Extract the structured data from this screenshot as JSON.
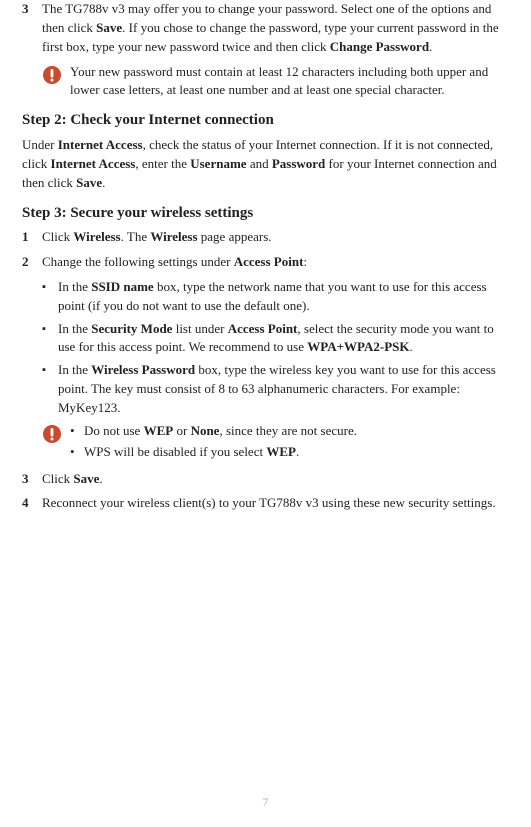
{
  "item3": {
    "num": "3",
    "t1": "The TG788v v3 may offer you to change your password. Select one of the options and then click ",
    "b1": "Save",
    "t2": ". If you chose to change the password, type your current password in the first box, type your new password twice and then click ",
    "b2": "Change Password",
    "t3": "."
  },
  "note1": "Your new password must contain at least 12 characters including both upper and lower case letters, at least one number and at least one special character.",
  "step2": {
    "heading": "Step 2: Check your Internet connection",
    "t1": "Under ",
    "b1": "Internet Access",
    "t2": ", check the status of your Internet connection. If it is not connected, click ",
    "b2": "Internet Access",
    "t3": ", enter the ",
    "b3": "Username",
    "t4": " and ",
    "b4": "Password",
    "t5": " for your Internet connection and then click ",
    "b5": "Save",
    "t6": "."
  },
  "step3": {
    "heading": "Step 3: Secure your wireless settings",
    "item1": {
      "num": "1",
      "t1": "Click ",
      "b1": "Wireless",
      "t2": ". The ",
      "b2": "Wireless",
      "t3": " page appears."
    },
    "item2": {
      "num": "2",
      "t1": "Change the following settings under ",
      "b1": "Access Point",
      "t2": ":"
    },
    "sub1": {
      "t1": "In the ",
      "b1": "SSID name",
      "t2": " box, type the network name that you want to use for this access point (if you do not want to use the default one)."
    },
    "sub2": {
      "t1": "In the ",
      "b1": "Security Mode",
      "t2": " list under ",
      "b2": "Access Point",
      "t3": ", select the security mode you want to use for this access point. We recommend to use ",
      "b3": "WPA+WPA2-PSK",
      "t4": "."
    },
    "sub3": {
      "t1": "In the ",
      "b1": "Wireless Password",
      "t2": " box, type the wireless key you want to use for this access point. The key must consist of 8 to 63 alphanumeric characters. For example: MyKey123."
    },
    "note2a": {
      "t1": "Do not use ",
      "b1": "WEP",
      "t2": " or ",
      "b2": "None",
      "t3": ", since they are not secure."
    },
    "note2b": {
      "t1": "WPS will be disabled if you select ",
      "b1": "WEP",
      "t2": "."
    },
    "item3b": {
      "num": "3",
      "t1": "Click ",
      "b1": "Save",
      "t2": "."
    },
    "item4": {
      "num": "4",
      "t1": "Reconnect your wireless client(s) to your TG788v v3 using these new security settings."
    }
  },
  "pageNumber": "7"
}
